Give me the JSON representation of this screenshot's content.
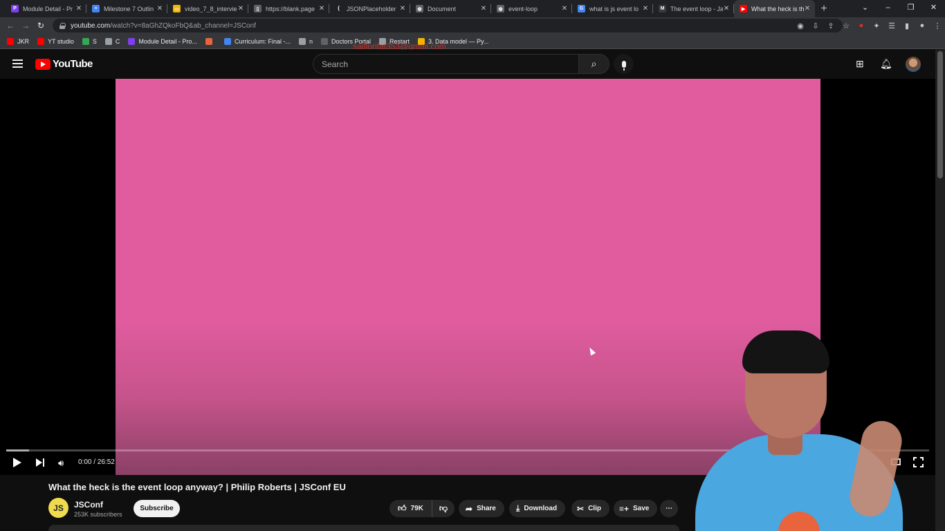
{
  "browser": {
    "tabs": [
      {
        "title": "Module Detail - Pr",
        "favicon_color": "#7e3ff2",
        "favicon_glyph": "P"
      },
      {
        "title": "Milestone 7 Outlin",
        "favicon_color": "#4285f4",
        "favicon_glyph": "≡"
      },
      {
        "title": "video_7_8_intervie",
        "favicon_color": "#f4b400",
        "favicon_glyph": "▭"
      },
      {
        "title": "https://blank.page",
        "favicon_color": "#5f6368",
        "favicon_glyph": "▯"
      },
      {
        "title": "JSONPlaceholder",
        "favicon_color": "#202124",
        "favicon_glyph": "{"
      },
      {
        "title": "Document",
        "favicon_color": "#5f6368",
        "favicon_glyph": "◍"
      },
      {
        "title": "event-loop",
        "favicon_color": "#5f6368",
        "favicon_glyph": "◍"
      },
      {
        "title": "what is js event lo",
        "favicon_color": "#4285f4",
        "favicon_glyph": "G"
      },
      {
        "title": "The event loop - Ja",
        "favicon_color": "#3a3a3a",
        "favicon_glyph": "M"
      },
      {
        "title": "What the heck is th",
        "favicon_color": "#ff0000",
        "favicon_glyph": "▶",
        "active": true
      }
    ],
    "new_tab_glyph": "+",
    "window_controls": {
      "dropdown": "⌄",
      "minimize": "–",
      "restore": "❐",
      "close": "✕"
    },
    "url_host": "youtube.com",
    "url_rest": "/watch?v=8aGhZQkoFbQ&ab_channel=JSConf",
    "bookmarks": [
      {
        "label": "JKR",
        "color": "#ff0000"
      },
      {
        "label": "YT studio",
        "color": "#ff0000"
      },
      {
        "label": "S",
        "color": "#34a853"
      },
      {
        "label": "C",
        "color": "#9aa0a6"
      },
      {
        "label": "Module Detail - Pro...",
        "color": "#7e3ff2"
      },
      {
        "label": "",
        "color": "#e8643c"
      },
      {
        "label": "Curriculum: Final -...",
        "color": "#4285f4"
      },
      {
        "label": "n",
        "color": "#9aa0a6"
      },
      {
        "label": "Doctors Portal",
        "color": "#5f6368"
      },
      {
        "label": "Restart",
        "color": "#9aa0a6"
      },
      {
        "label": "3. Data model — Py...",
        "color": "#f4b400"
      }
    ],
    "overlay_email": "saiflorifat353@gmail.com"
  },
  "youtube": {
    "logo_text": "YouTube",
    "search_placeholder": "Search",
    "player": {
      "current_time": "0:00",
      "duration": "26:52",
      "time_display": "0:00 / 26:52",
      "progress_fraction": 0.0,
      "video_bg_color": "#e05c9e"
    },
    "video": {
      "title": "What the heck is the event loop anyway? | Philip Roberts | JSConf EU",
      "channel_name": "JSConf",
      "channel_avatar_text": "JS",
      "subscribers": "253K subscribers",
      "subscribe_label": "Subscribe",
      "likes": "79K",
      "share_label": "Share",
      "download_label": "Download",
      "clip_label": "Clip",
      "save_label": "Save",
      "more_glyph": "⋯"
    }
  }
}
